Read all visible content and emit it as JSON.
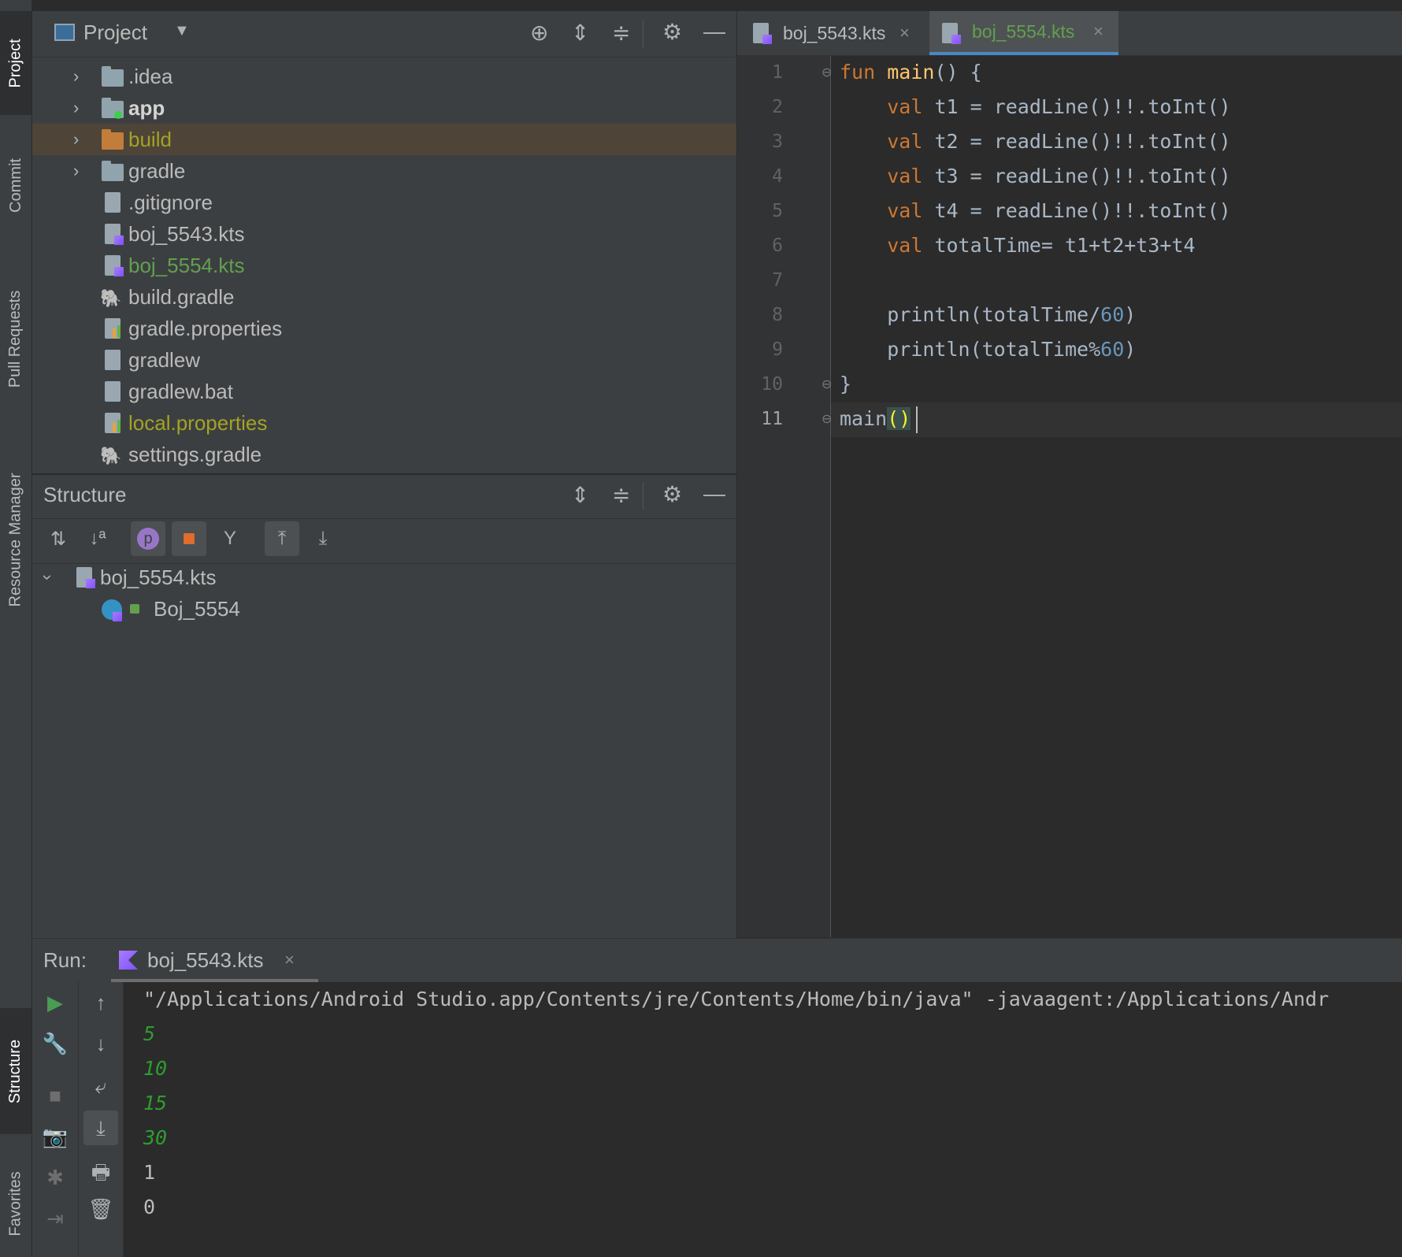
{
  "left_strip": {
    "tabs": [
      "Project",
      "Commit",
      "Pull Requests",
      "Resource Manager",
      "Structure",
      "Favorites"
    ]
  },
  "project_panel": {
    "title": "Project",
    "items": [
      {
        "label": ".idea",
        "type": "folder",
        "expandable": true
      },
      {
        "label": "app",
        "type": "module-folder",
        "expandable": true
      },
      {
        "label": "build",
        "type": "folder-excluded",
        "expandable": true
      },
      {
        "label": "gradle",
        "type": "folder",
        "expandable": true
      },
      {
        "label": ".gitignore",
        "type": "file"
      },
      {
        "label": "boj_5543.kts",
        "type": "kotlin-script"
      },
      {
        "label": "boj_5554.kts",
        "type": "kotlin-script"
      },
      {
        "label": "build.gradle",
        "type": "gradle"
      },
      {
        "label": "gradle.properties",
        "type": "properties"
      },
      {
        "label": "gradlew",
        "type": "shell"
      },
      {
        "label": "gradlew.bat",
        "type": "file"
      },
      {
        "label": "local.properties",
        "type": "properties"
      },
      {
        "label": "settings.gradle",
        "type": "gradle"
      }
    ]
  },
  "structure_panel": {
    "title": "Structure",
    "root": "boj_5554.kts",
    "child": "Boj_5554",
    "p_badge": "p"
  },
  "editor": {
    "tabs": [
      {
        "label": "boj_5543.kts",
        "active": false
      },
      {
        "label": "boj_5554.kts",
        "active": true
      }
    ],
    "line_numbers": [
      "1",
      "2",
      "3",
      "4",
      "5",
      "6",
      "7",
      "8",
      "9",
      "10",
      "11"
    ],
    "code": {
      "l1_kw": "fun",
      "l1_fn": "main",
      "l1_rest": "() {",
      "l2_kw": "val",
      "l2_rest": "t1 = readLine()!!.toInt()",
      "l3_kw": "val",
      "l3_rest": "t2 = readLine()!!.toInt()",
      "l4_kw": "val",
      "l4_rest": "t3 = readLine()!!.toInt()",
      "l5_kw": "val",
      "l5_rest": "t4 = readLine()!!.toInt()",
      "l6_kw": "val",
      "l6_rest": "totalTime= t1+t2+t3+t4",
      "l8_a": "println(totalTime/",
      "l8_num": "60",
      "l8_b": ")",
      "l9_a": "println(totalTime%",
      "l9_num": "60",
      "l9_b": ")",
      "l10": "}",
      "l11_a": "main",
      "l11_brk": "()"
    }
  },
  "run_panel": {
    "label": "Run:",
    "tab": "boj_5543.kts",
    "command": "\"/Applications/Android Studio.app/Contents/jre/Contents/Home/bin/java\" -javaagent:/Applications/Andr",
    "inputs": [
      "5",
      "10",
      "15",
      "30"
    ],
    "outputs": [
      "1",
      "0"
    ]
  }
}
